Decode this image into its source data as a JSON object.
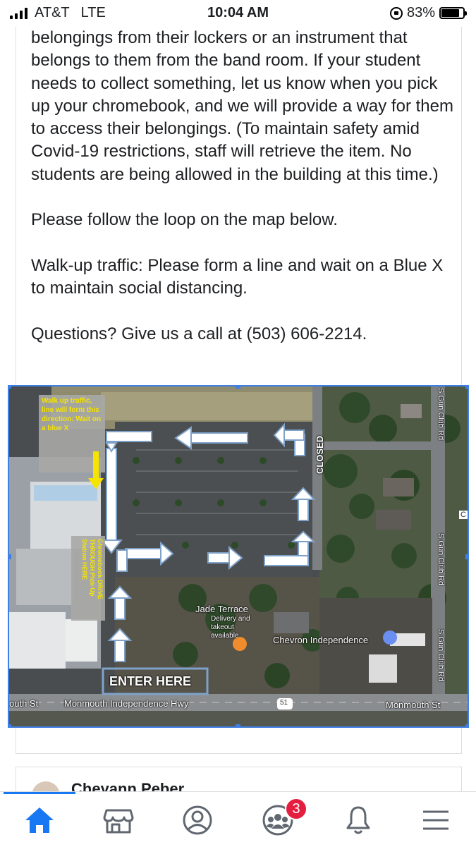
{
  "status_bar": {
    "carrier": "AT&T",
    "network": "LTE",
    "time": "10:04 AM",
    "battery_percent": "83%",
    "battery_level": 0.83
  },
  "post": {
    "paragraph_1": "belongings from their lockers or an instrument that belongs to them from the band room. If your student needs to collect something, let us know when you pick up your chromebook, and we will provide a way for them to access their belongings. (To maintain safety amid Covid-19 restrictions, staff will retrieve the item. No students are being allowed in the building at this time.)",
    "paragraph_2": "Please follow the loop on the map below.",
    "paragraph_3": "Walk-up traffic: Please form a line and wait on a Blue X to maintain social distancing.",
    "paragraph_4": "Questions? Give us a call at (503) 606-2214."
  },
  "map": {
    "walkup_note": "Walk up traffic, line will form this direction: Wait on a blue X",
    "station_note": "Chromebook DRIVE THROUGH Pick-Up Station HERE",
    "closed_label": "CLOSED",
    "enter_label": "ENTER HERE",
    "place_jade": "Jade Terrace",
    "place_jade_sub": "Delivery and takeout available",
    "place_chevron": "Chevron Independence",
    "road_gun_club_1": "S Gun Club Rd",
    "road_gun_club_2": "S Gun Club Rd",
    "road_gun_club_3": "S Gun Club Rd",
    "road_hwy": "Monmouth Independence Hwy",
    "road_south": "outh St",
    "road_monmouth": "Monmouth St",
    "route_shield": "51",
    "edge_letter": "C"
  },
  "next_post": {
    "author": "Cheyann Peber"
  },
  "tabbar": {
    "tabs": [
      "home",
      "marketplace",
      "profile",
      "groups",
      "notifications",
      "menu"
    ],
    "groups_badge": "3"
  },
  "colors": {
    "accent": "#1877f2",
    "selection": "#3f80e6",
    "badge": "#e41e3f",
    "note_yellow": "#f5e400"
  }
}
